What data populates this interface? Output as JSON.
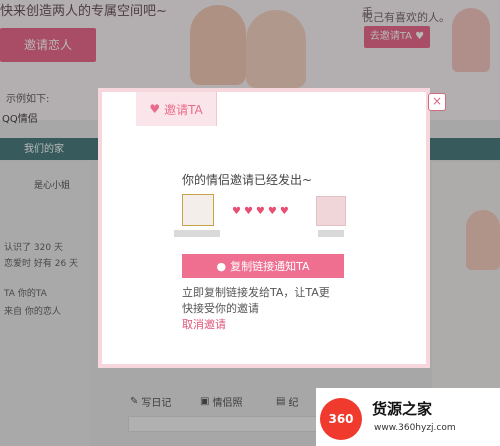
{
  "background": {
    "headline": "快来创造两人的专属空间吧~",
    "invite_button": "邀请恋人",
    "right_text_1": "手",
    "right_text_2": "悦己有喜欢的人。",
    "right_button": "去邀请TA ♥",
    "example_label": "示例如下:",
    "qq_label": "QQ情侣",
    "nav_tab": "我们的家",
    "left_name": "是心小姐",
    "left_lines": [
      "认识了 320 天",
      "恋爱时 好有 26 天",
      "TA 你的TA",
      "来自 你的恋人"
    ],
    "tools": [
      "写日记",
      "情侣照",
      "纪"
    ]
  },
  "modal": {
    "tab_label": "邀请TA",
    "title": "你的情侣邀请已经发出~",
    "hearts": "♥♥♥♥♥",
    "copy_button": "复制链接通知TA",
    "description_line1": "立即复制链接发给TA，让TA更",
    "description_line2": "快接受你的邀请",
    "cancel_link": "取消邀请",
    "close_glyph": "×"
  },
  "watermark": {
    "logo_text": "360",
    "title": "货源之家",
    "url": "www.360hyzj.com"
  },
  "colors": {
    "accent": "#ee6f8f",
    "modal_border": "#f6d7de"
  }
}
